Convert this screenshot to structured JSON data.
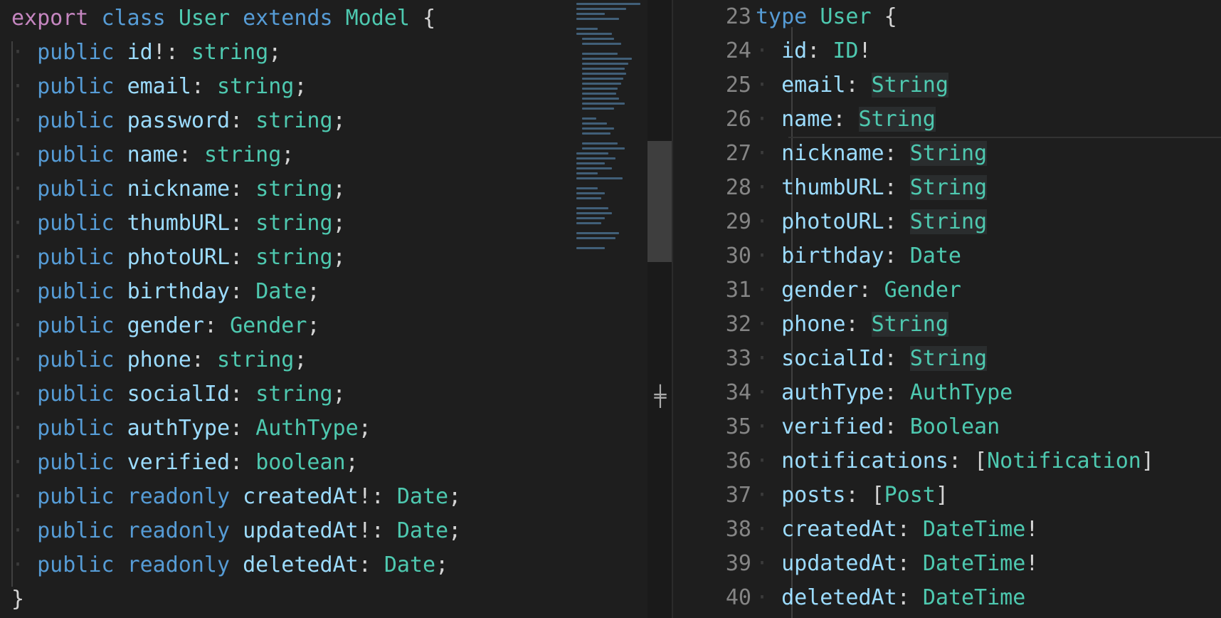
{
  "left_editor": {
    "lines": [
      [
        {
          "t": "export",
          "c": "kw"
        },
        {
          "t": " ",
          "c": "ws"
        },
        {
          "t": "class",
          "c": "st"
        },
        {
          "t": " ",
          "c": "ws"
        },
        {
          "t": "User",
          "c": "ty"
        },
        {
          "t": " ",
          "c": "ws"
        },
        {
          "t": "extends",
          "c": "st"
        },
        {
          "t": " ",
          "c": "ws"
        },
        {
          "t": "Model",
          "c": "ty"
        },
        {
          "t": " {",
          "c": "pu"
        }
      ],
      [
        {
          "t": "· ",
          "c": "ws"
        },
        {
          "t": "public",
          "c": "st"
        },
        {
          "t": " ",
          "c": "ws"
        },
        {
          "t": "id",
          "c": "pr"
        },
        {
          "t": "!: ",
          "c": "pu"
        },
        {
          "t": "string",
          "c": "ty"
        },
        {
          "t": ";",
          "c": "pu"
        }
      ],
      [
        {
          "t": "· ",
          "c": "ws"
        },
        {
          "t": "public",
          "c": "st"
        },
        {
          "t": " ",
          "c": "ws"
        },
        {
          "t": "email",
          "c": "pr"
        },
        {
          "t": ": ",
          "c": "pu"
        },
        {
          "t": "string",
          "c": "ty"
        },
        {
          "t": ";",
          "c": "pu"
        }
      ],
      [
        {
          "t": "· ",
          "c": "ws"
        },
        {
          "t": "public",
          "c": "st"
        },
        {
          "t": " ",
          "c": "ws"
        },
        {
          "t": "password",
          "c": "pr"
        },
        {
          "t": ": ",
          "c": "pu"
        },
        {
          "t": "string",
          "c": "ty"
        },
        {
          "t": ";",
          "c": "pu"
        }
      ],
      [
        {
          "t": "· ",
          "c": "ws"
        },
        {
          "t": "public",
          "c": "st"
        },
        {
          "t": " ",
          "c": "ws"
        },
        {
          "t": "name",
          "c": "pr"
        },
        {
          "t": ": ",
          "c": "pu"
        },
        {
          "t": "string",
          "c": "ty"
        },
        {
          "t": ";",
          "c": "pu"
        }
      ],
      [
        {
          "t": "· ",
          "c": "ws"
        },
        {
          "t": "public",
          "c": "st"
        },
        {
          "t": " ",
          "c": "ws"
        },
        {
          "t": "nickname",
          "c": "pr"
        },
        {
          "t": ": ",
          "c": "pu"
        },
        {
          "t": "string",
          "c": "ty"
        },
        {
          "t": ";",
          "c": "pu"
        }
      ],
      [
        {
          "t": "· ",
          "c": "ws"
        },
        {
          "t": "public",
          "c": "st"
        },
        {
          "t": " ",
          "c": "ws"
        },
        {
          "t": "thumbURL",
          "c": "pr"
        },
        {
          "t": ": ",
          "c": "pu"
        },
        {
          "t": "string",
          "c": "ty"
        },
        {
          "t": ";",
          "c": "pu"
        }
      ],
      [
        {
          "t": "· ",
          "c": "ws"
        },
        {
          "t": "public",
          "c": "st"
        },
        {
          "t": " ",
          "c": "ws"
        },
        {
          "t": "photoURL",
          "c": "pr"
        },
        {
          "t": ": ",
          "c": "pu"
        },
        {
          "t": "string",
          "c": "ty"
        },
        {
          "t": ";",
          "c": "pu"
        }
      ],
      [
        {
          "t": "· ",
          "c": "ws"
        },
        {
          "t": "public",
          "c": "st"
        },
        {
          "t": " ",
          "c": "ws"
        },
        {
          "t": "birthday",
          "c": "pr"
        },
        {
          "t": ": ",
          "c": "pu"
        },
        {
          "t": "Date",
          "c": "ty"
        },
        {
          "t": ";",
          "c": "pu"
        }
      ],
      [
        {
          "t": "· ",
          "c": "ws"
        },
        {
          "t": "public",
          "c": "st"
        },
        {
          "t": " ",
          "c": "ws"
        },
        {
          "t": "gender",
          "c": "pr"
        },
        {
          "t": ": ",
          "c": "pu"
        },
        {
          "t": "Gender",
          "c": "ty"
        },
        {
          "t": ";",
          "c": "pu"
        }
      ],
      [
        {
          "t": "· ",
          "c": "ws"
        },
        {
          "t": "public",
          "c": "st"
        },
        {
          "t": " ",
          "c": "ws"
        },
        {
          "t": "phone",
          "c": "pr"
        },
        {
          "t": ": ",
          "c": "pu"
        },
        {
          "t": "string",
          "c": "ty"
        },
        {
          "t": ";",
          "c": "pu"
        }
      ],
      [
        {
          "t": "· ",
          "c": "ws"
        },
        {
          "t": "public",
          "c": "st"
        },
        {
          "t": " ",
          "c": "ws"
        },
        {
          "t": "socialId",
          "c": "pr"
        },
        {
          "t": ": ",
          "c": "pu"
        },
        {
          "t": "string",
          "c": "ty"
        },
        {
          "t": ";",
          "c": "pu"
        }
      ],
      [
        {
          "t": "· ",
          "c": "ws"
        },
        {
          "t": "public",
          "c": "st"
        },
        {
          "t": " ",
          "c": "ws"
        },
        {
          "t": "authType",
          "c": "pr"
        },
        {
          "t": ": ",
          "c": "pu"
        },
        {
          "t": "AuthType",
          "c": "ty"
        },
        {
          "t": ";",
          "c": "pu"
        }
      ],
      [
        {
          "t": "· ",
          "c": "ws"
        },
        {
          "t": "public",
          "c": "st"
        },
        {
          "t": " ",
          "c": "ws"
        },
        {
          "t": "verified",
          "c": "pr"
        },
        {
          "t": ": ",
          "c": "pu"
        },
        {
          "t": "boolean",
          "c": "ty"
        },
        {
          "t": ";",
          "c": "pu"
        }
      ],
      [
        {
          "t": "· ",
          "c": "ws"
        },
        {
          "t": "public",
          "c": "st"
        },
        {
          "t": " ",
          "c": "ws"
        },
        {
          "t": "readonly",
          "c": "st"
        },
        {
          "t": " ",
          "c": "ws"
        },
        {
          "t": "createdAt",
          "c": "pr"
        },
        {
          "t": "!: ",
          "c": "pu"
        },
        {
          "t": "Date",
          "c": "ty"
        },
        {
          "t": ";",
          "c": "pu"
        }
      ],
      [
        {
          "t": "· ",
          "c": "ws"
        },
        {
          "t": "public",
          "c": "st"
        },
        {
          "t": " ",
          "c": "ws"
        },
        {
          "t": "readonly",
          "c": "st"
        },
        {
          "t": " ",
          "c": "ws"
        },
        {
          "t": "updatedAt",
          "c": "pr"
        },
        {
          "t": "!: ",
          "c": "pu"
        },
        {
          "t": "Date",
          "c": "ty"
        },
        {
          "t": ";",
          "c": "pu"
        }
      ],
      [
        {
          "t": "· ",
          "c": "ws"
        },
        {
          "t": "public",
          "c": "st"
        },
        {
          "t": " ",
          "c": "ws"
        },
        {
          "t": "readonly",
          "c": "st"
        },
        {
          "t": " ",
          "c": "ws"
        },
        {
          "t": "deletedAt",
          "c": "pr"
        },
        {
          "t": ": ",
          "c": "pu"
        },
        {
          "t": "Date",
          "c": "ty"
        },
        {
          "t": ";",
          "c": "pu"
        }
      ],
      [
        {
          "t": "}",
          "c": "pu"
        }
      ]
    ]
  },
  "right_editor": {
    "line_numbers": [
      "23",
      "24",
      "25",
      "26",
      "27",
      "28",
      "29",
      "30",
      "31",
      "32",
      "33",
      "34",
      "35",
      "36",
      "37",
      "38",
      "39",
      "40"
    ],
    "lines": [
      [
        {
          "t": "type",
          "c": "st"
        },
        {
          "t": " ",
          "c": "ws"
        },
        {
          "t": "User",
          "c": "ty"
        },
        {
          "t": " ",
          "c": "ws"
        },
        {
          "t": "{",
          "c": "pu"
        }
      ],
      [
        {
          "t": "· ",
          "c": "ws"
        },
        {
          "t": "id",
          "c": "pr"
        },
        {
          "t": ": ",
          "c": "pu"
        },
        {
          "t": "ID",
          "c": "ty"
        },
        {
          "t": "!",
          "c": "pu"
        }
      ],
      [
        {
          "t": "· ",
          "c": "ws"
        },
        {
          "t": "email",
          "c": "pr"
        },
        {
          "t": ": ",
          "c": "pu"
        },
        {
          "t": "String",
          "c": "ty",
          "h": true
        }
      ],
      [
        {
          "t": "· ",
          "c": "ws"
        },
        {
          "t": "name",
          "c": "pr"
        },
        {
          "t": ": ",
          "c": "pu"
        },
        {
          "t": "String",
          "c": "ty",
          "h": true
        }
      ],
      [
        {
          "t": "· ",
          "c": "ws"
        },
        {
          "t": "nickname",
          "c": "pr"
        },
        {
          "t": ": ",
          "c": "pu"
        },
        {
          "t": "String",
          "c": "ty",
          "h": true
        }
      ],
      [
        {
          "t": "· ",
          "c": "ws"
        },
        {
          "t": "thumbURL",
          "c": "pr"
        },
        {
          "t": ": ",
          "c": "pu"
        },
        {
          "t": "String",
          "c": "ty",
          "h": true
        }
      ],
      [
        {
          "t": "· ",
          "c": "ws"
        },
        {
          "t": "photoURL",
          "c": "pr"
        },
        {
          "t": ": ",
          "c": "pu"
        },
        {
          "t": "String",
          "c": "ty",
          "h": true
        }
      ],
      [
        {
          "t": "· ",
          "c": "ws"
        },
        {
          "t": "birthday",
          "c": "pr"
        },
        {
          "t": ": ",
          "c": "pu"
        },
        {
          "t": "Date",
          "c": "ty"
        }
      ],
      [
        {
          "t": "· ",
          "c": "ws"
        },
        {
          "t": "gender",
          "c": "pr"
        },
        {
          "t": ": ",
          "c": "pu"
        },
        {
          "t": "Gender",
          "c": "ty"
        }
      ],
      [
        {
          "t": "· ",
          "c": "ws"
        },
        {
          "t": "phone",
          "c": "pr"
        },
        {
          "t": ": ",
          "c": "pu"
        },
        {
          "t": "String",
          "c": "ty",
          "h": true
        }
      ],
      [
        {
          "t": "· ",
          "c": "ws"
        },
        {
          "t": "socialId",
          "c": "pr"
        },
        {
          "t": ": ",
          "c": "pu"
        },
        {
          "t": "String",
          "c": "ty",
          "h": true
        }
      ],
      [
        {
          "t": "· ",
          "c": "ws"
        },
        {
          "t": "authType",
          "c": "pr"
        },
        {
          "t": ": ",
          "c": "pu"
        },
        {
          "t": "AuthType",
          "c": "ty"
        }
      ],
      [
        {
          "t": "· ",
          "c": "ws"
        },
        {
          "t": "verified",
          "c": "pr"
        },
        {
          "t": ": ",
          "c": "pu"
        },
        {
          "t": "Boolean",
          "c": "ty"
        }
      ],
      [
        {
          "t": "· ",
          "c": "ws"
        },
        {
          "t": "notifications",
          "c": "pr"
        },
        {
          "t": ": ",
          "c": "pu"
        },
        {
          "t": "[",
          "c": "pu"
        },
        {
          "t": "Notification",
          "c": "ty"
        },
        {
          "t": "]",
          "c": "pu"
        }
      ],
      [
        {
          "t": "· ",
          "c": "ws"
        },
        {
          "t": "posts",
          "c": "pr"
        },
        {
          "t": ": ",
          "c": "pu"
        },
        {
          "t": "[",
          "c": "pu"
        },
        {
          "t": "Post",
          "c": "ty"
        },
        {
          "t": "]",
          "c": "pu"
        }
      ],
      [
        {
          "t": "· ",
          "c": "ws"
        },
        {
          "t": "createdAt",
          "c": "pr"
        },
        {
          "t": ": ",
          "c": "pu"
        },
        {
          "t": "DateTime",
          "c": "ty"
        },
        {
          "t": "!",
          "c": "pu"
        }
      ],
      [
        {
          "t": "· ",
          "c": "ws"
        },
        {
          "t": "updatedAt",
          "c": "pr"
        },
        {
          "t": ": ",
          "c": "pu"
        },
        {
          "t": "DateTime",
          "c": "ty"
        },
        {
          "t": "!",
          "c": "pu"
        }
      ],
      [
        {
          "t": "· ",
          "c": "ws"
        },
        {
          "t": "deletedAt",
          "c": "pr"
        },
        {
          "t": ": ",
          "c": "pu"
        },
        {
          "t": "DateTime",
          "c": "ty"
        }
      ]
    ]
  },
  "colors": {
    "background": "#1e1e1e",
    "keyword_export": "#c586c0",
    "storage": "#569cd6",
    "type": "#4ec9b0",
    "property": "#9cdcfe",
    "line_number": "#858585"
  },
  "icons": {
    "sash": "sash-handle-icon"
  }
}
